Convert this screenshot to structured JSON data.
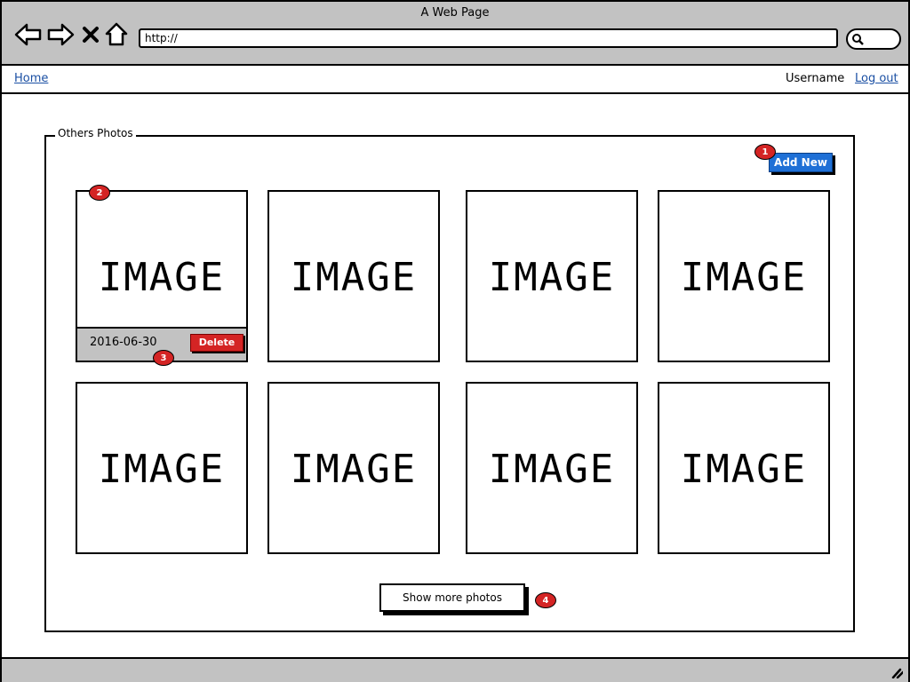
{
  "browser": {
    "window_title": "A Web Page",
    "url": "http://",
    "icons": [
      "back-arrow-icon",
      "forward-arrow-icon",
      "close-x-icon",
      "home-icon",
      "search-icon"
    ]
  },
  "nav": {
    "home_label": "Home",
    "username": "Username",
    "logout_label": "Log out"
  },
  "panel": {
    "legend": "Others Photos",
    "add_new_label": "Add New",
    "show_more_label": "Show more photos"
  },
  "photos": [
    {
      "image_text": "IMAGE",
      "date": "2016-06-30",
      "delete_label": "Delete"
    },
    {
      "image_text": "IMAGE"
    },
    {
      "image_text": "IMAGE"
    },
    {
      "image_text": "IMAGE"
    },
    {
      "image_text": "IMAGE"
    },
    {
      "image_text": "IMAGE"
    },
    {
      "image_text": "IMAGE"
    },
    {
      "image_text": "IMAGE"
    }
  ],
  "annotations": [
    "1",
    "2",
    "3",
    "4"
  ],
  "colors": {
    "chrome": "#c2c2c2",
    "link": "#1a4fa3",
    "primary_button": "#1f70d6",
    "delete_button": "#d42424",
    "badge": "#d42424"
  }
}
